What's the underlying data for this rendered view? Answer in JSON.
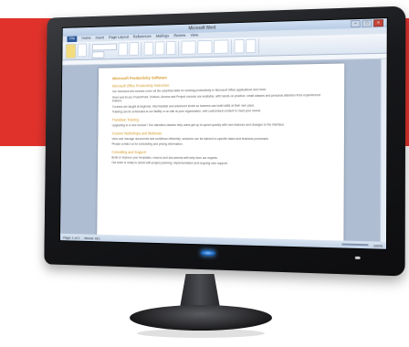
{
  "window": {
    "title": "Microsoft Word",
    "controls": [
      "–",
      "□",
      "×"
    ]
  },
  "ribbon": {
    "file_tab": "File",
    "tabs": [
      "Home",
      "Insert",
      "Page Layout",
      "References",
      "Mailings",
      "Review",
      "View"
    ]
  },
  "document": {
    "title": "Microsoft Productivity Software",
    "sections": [
      {
        "heading": "Microsoft Office Productivity Instruction",
        "paragraphs": [
          "Our instructor-led courses cover all the essential skills for working productively in Microsoft Office applications and more.",
          "Word and Excel, PowerPoint, Outlook, Access and Project courses are available, with hands-on practice, small classes and personal attention from experienced trainers.",
          "Courses are taught at beginner, intermediate and advanced levels so learners can build skills at their own pace.",
          "Training can be scheduled at our facility or on-site at your organization, with customized content to meet your needs."
        ]
      },
      {
        "heading": "Transition Training",
        "paragraphs": [
          "Upgrading to a new version? Our transition classes help users get up to speed quickly with new features and changes to the interface."
        ]
      },
      {
        "heading": "Custom Workshops and Webinars",
        "paragraphs": [
          "View and manage documents and workflows efficiently; sessions can be tailored to specific tasks and business processes.",
          "Please contact us for scheduling and pricing information."
        ]
      },
      {
        "heading": "Consulting and Support",
        "paragraphs": [
          "Build or improve your templates, macros and documents with help from our experts.",
          "Our team is ready to assist with project planning, implementation and ongoing user support."
        ]
      }
    ]
  },
  "statusbar": {
    "page": "Page: 1 of 1",
    "words": "Words: 412",
    "zoom": "100%"
  },
  "colors": {
    "background_band": "#e0322b",
    "heading": "#d39a2a",
    "monitor": "#17181b"
  }
}
